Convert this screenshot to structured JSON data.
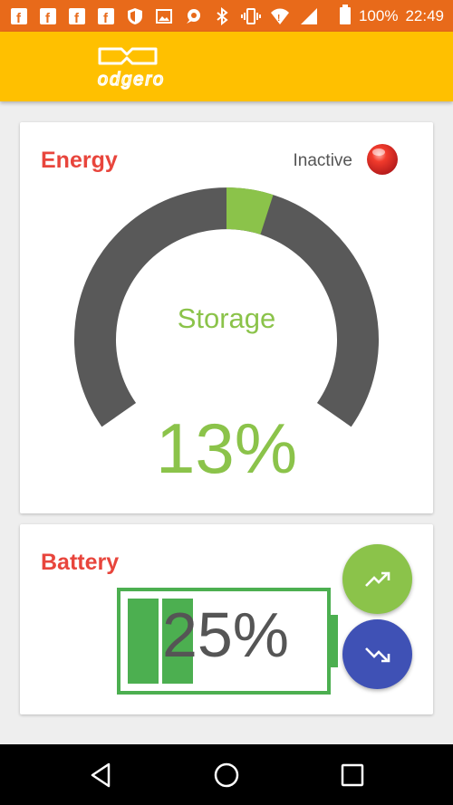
{
  "status_bar": {
    "battery_percent": "100%",
    "time": "22:49",
    "color": "#e86a1a"
  },
  "app_bar": {
    "logo_text": "odgero",
    "color": "#ffc000"
  },
  "energy": {
    "title": "Energy",
    "status": "Inactive",
    "status_color": "#e53935",
    "gauge_label": "Storage",
    "percent_text": "13%",
    "fill_fraction": 0.13,
    "accent": "#8bc34a"
  },
  "battery": {
    "title": "Battery",
    "percent_text": "25%",
    "fill_fraction": 0.25,
    "accent": "#4caf50",
    "buttons": {
      "up_icon": "trending-up-icon",
      "down_icon": "trending-down-icon"
    }
  },
  "nav": {
    "icons": [
      "back-icon",
      "home-icon",
      "recents-icon"
    ]
  }
}
